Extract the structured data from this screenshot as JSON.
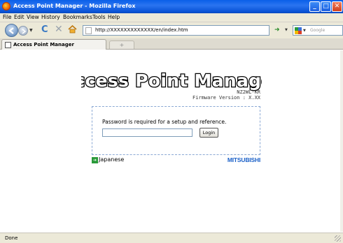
{
  "window": {
    "title": "Access Point Manager - Mozilla Firefox"
  },
  "menubar": {
    "items": [
      {
        "label": "File"
      },
      {
        "label": "Edit"
      },
      {
        "label": "View"
      },
      {
        "label": "History"
      },
      {
        "label": "Bookmarks"
      },
      {
        "label": "Tools"
      },
      {
        "label": "Help"
      }
    ]
  },
  "navbar": {
    "url": "http://XXXXXXXXXXXXX/en/index.htm",
    "search_placeholder": "Google"
  },
  "tabs": [
    {
      "label": "Access Point Manager"
    }
  ],
  "newtab_label": "+",
  "page": {
    "logo_text": "Access Point Manager",
    "model": "NZ2WL-KR",
    "firmware_label": "Firmware Version",
    "firmware_sep": " : ",
    "firmware_value": "X.XX",
    "login_message": "Password is required for a setup and reference.",
    "login_button": "Login",
    "language_link": "Japanese",
    "brand": "MITSUBISHI"
  },
  "statusbar": {
    "status": "Done"
  },
  "colors": {
    "titlebar": "#0a5fe8",
    "brand": "#1a60c8",
    "login_border": "#8aa8d4"
  }
}
